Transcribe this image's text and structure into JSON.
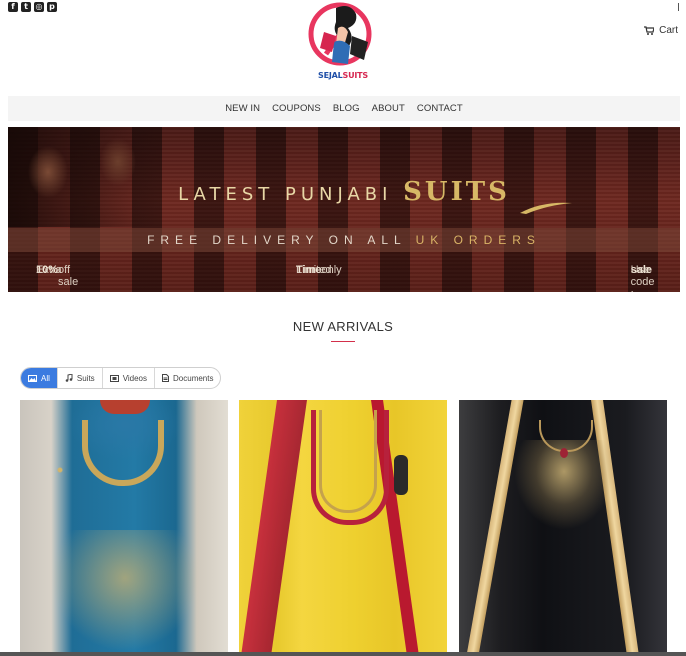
{
  "social": {
    "icons": [
      "facebook-icon",
      "twitter-icon",
      "instagram-icon",
      "pinterest-icon"
    ],
    "glyphs": [
      "f",
      "t",
      "◎",
      "p"
    ]
  },
  "header": {
    "cart_label": "Cart",
    "logo": {
      "part1": "SEJAL",
      "part2": "SUITS",
      "colors": {
        "blue": "#1f4fa8",
        "pink": "#d6264f"
      }
    }
  },
  "nav": {
    "items": [
      "NEW IN",
      "COUPONS",
      "BLOG",
      "ABOUT",
      "CONTACT"
    ]
  },
  "banner": {
    "title_prefix": "LATEST PUNJABI",
    "title_accent": "SUITS",
    "strip_prefix": "FREE DELIVERY ON ALL",
    "strip_accent": "UK ORDERS",
    "left": {
      "pre": "Extra",
      "bold": "10%",
      "post": "off sale"
    },
    "middle": {
      "pre": "Limited",
      "bold": "Time",
      "post": "only"
    },
    "right": {
      "pre": "Use code :",
      "bold": "sale"
    }
  },
  "section": {
    "title": "NEW ARRIVALS",
    "accent_color": "#d32f4a"
  },
  "filters": {
    "active_color": "#3b7be0",
    "tabs": [
      {
        "label": "All",
        "icon": "image-icon",
        "active": true
      },
      {
        "label": "Suits",
        "icon": "music-icon",
        "active": false
      },
      {
        "label": "Videos",
        "icon": "film-icon",
        "active": false
      },
      {
        "label": "Documents",
        "icon": "document-icon",
        "active": false
      }
    ]
  },
  "products": [
    {
      "name": "blue-embroidered-suit"
    },
    {
      "name": "yellow-red-suit"
    },
    {
      "name": "black-gold-suit"
    }
  ]
}
